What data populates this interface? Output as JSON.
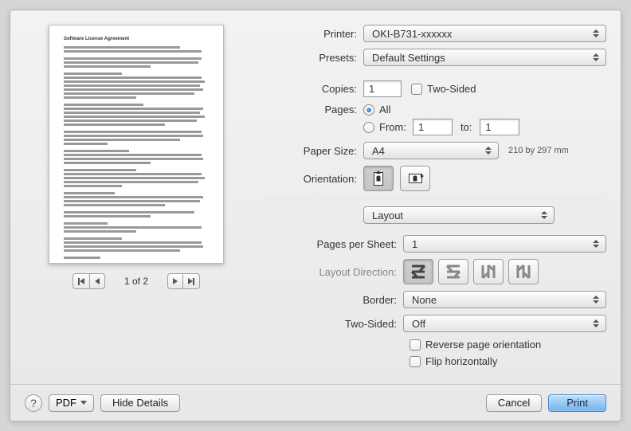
{
  "printer": {
    "label": "Printer:",
    "value": "OKI-B731-xxxxxx"
  },
  "presets": {
    "label": "Presets:",
    "value": "Default Settings"
  },
  "copies": {
    "label": "Copies:",
    "value": "1",
    "two_sided_label": "Two-Sided"
  },
  "pages": {
    "label": "Pages:",
    "all_label": "All",
    "from_label": "From:",
    "to_label": "to:",
    "from_value": "1",
    "to_value": "1"
  },
  "paper_size": {
    "label": "Paper Size:",
    "value": "A4",
    "note": "210 by 297 mm"
  },
  "orientation": {
    "label": "Orientation:"
  },
  "section_select": {
    "value": "Layout"
  },
  "pages_per_sheet": {
    "label": "Pages per Sheet:",
    "value": "1"
  },
  "layout_direction": {
    "label": "Layout Direction:"
  },
  "border": {
    "label": "Border:",
    "value": "None"
  },
  "two_sided": {
    "label": "Two-Sided:",
    "value": "Off"
  },
  "reverse_label": "Reverse page orientation",
  "flip_label": "Flip horizontally",
  "preview": {
    "page_indicator": "1 of 2",
    "doc_title": "Software License Agreement"
  },
  "footer": {
    "help": "?",
    "pdf_label": "PDF",
    "hide_details": "Hide Details",
    "cancel": "Cancel",
    "print": "Print"
  }
}
